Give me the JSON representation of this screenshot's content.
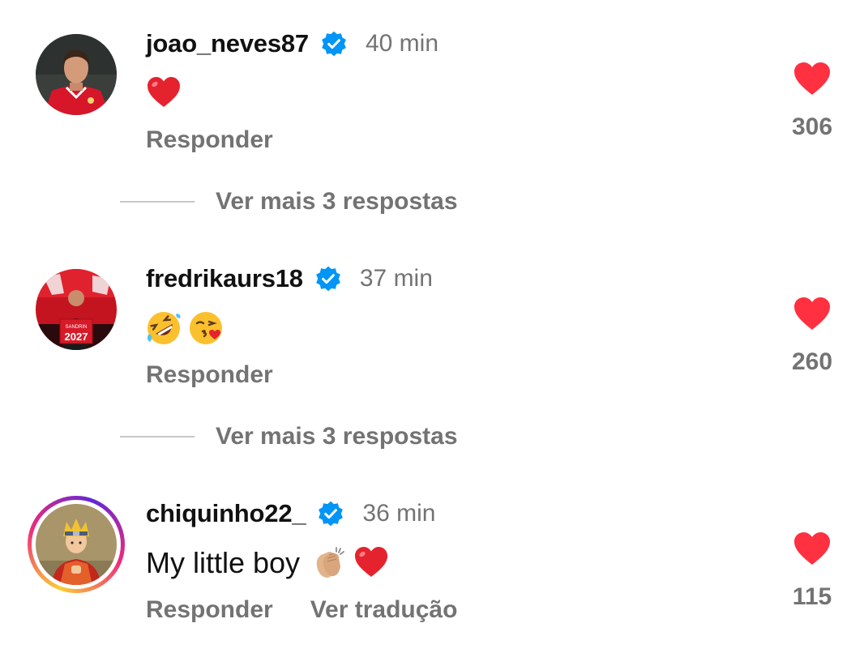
{
  "colors": {
    "like_red": "#ff3040",
    "verified_blue": "#0095f6",
    "muted_text": "#737373"
  },
  "comments": [
    {
      "username": "joao_neves87",
      "verified": true,
      "timestamp": "40 min",
      "text": "",
      "emojis": [
        "red-heart-emoji"
      ],
      "reply_label": "Responder",
      "likes": "306",
      "view_replies": "Ver mais 3 respostas"
    },
    {
      "username": "fredrikaurs18",
      "verified": true,
      "timestamp": "37 min",
      "text": "",
      "emojis": [
        "rolling-laughing-emoji",
        "blowing-kiss-emoji"
      ],
      "reply_label": "Responder",
      "likes": "260",
      "view_replies": "Ver mais 3 respostas",
      "avatar_jersey_text": "2027"
    },
    {
      "username": "chiquinho22_",
      "verified": true,
      "timestamp": "36 min",
      "text": "My little boy",
      "emojis": [
        "clapping-hands-emoji",
        "red-heart-emoji"
      ],
      "reply_label": "Responder",
      "translate_label": "Ver tradução",
      "likes": "115"
    }
  ]
}
